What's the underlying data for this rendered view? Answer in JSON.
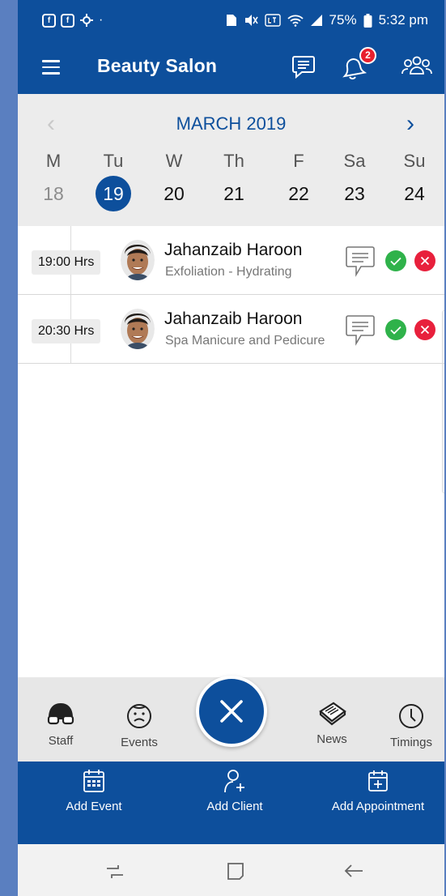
{
  "status_bar": {
    "left_icons": [
      "notification-icon",
      "notification-icon",
      "mode-icon"
    ],
    "right_icons": [
      "sim-icon",
      "mute-icon",
      "volte-lte-icon",
      "wifi-icon",
      "signal-icon"
    ],
    "battery": "75%",
    "time": "5:32 pm",
    "dot": "·"
  },
  "app_bar": {
    "title": "Beauty Salon",
    "notification_count": "2"
  },
  "calendar": {
    "month": "MARCH 2019",
    "prev": "‹",
    "next": "›",
    "weekdays": [
      "M",
      "Tu",
      "W",
      "Th",
      "F",
      "Sa",
      "Su"
    ],
    "dates": [
      "18",
      "19",
      "20",
      "21",
      "22",
      "23",
      "24"
    ],
    "selected_index": 1
  },
  "appointments": [
    {
      "time": "19:00 Hrs",
      "client": "Jahanzaib Haroon",
      "service": "Exfoliation - Hydrating"
    },
    {
      "time": "20:30 Hrs",
      "client": "Jahanzaib Haroon",
      "service": "Spa Manicure and Pedicure"
    }
  ],
  "toolbar": {
    "staff": "Staff",
    "events": "Events",
    "news": "News",
    "timings": "Timings"
  },
  "actions": {
    "add_event": "Add Event",
    "add_client": "Add Client",
    "add_appointment": "Add Appointment"
  },
  "colors": {
    "primary": "#0d4f9c",
    "accept": "#2fb24a",
    "reject": "#e8203c",
    "badge": "#e8202e"
  }
}
